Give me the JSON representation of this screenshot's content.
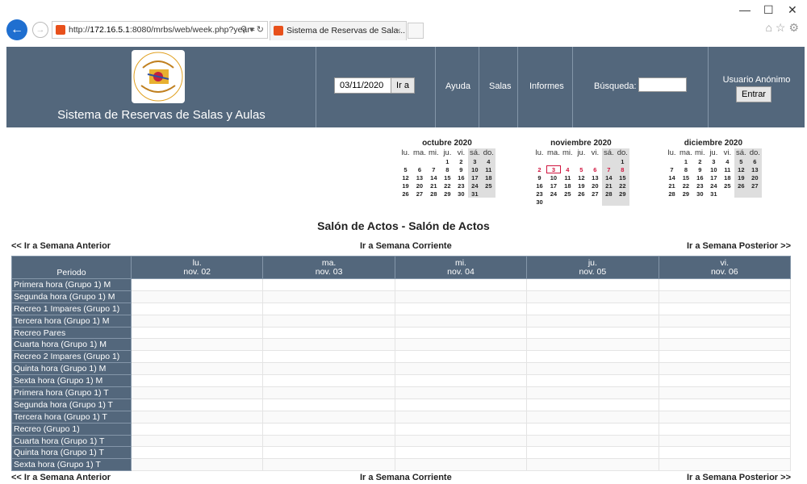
{
  "browser": {
    "url_prefix": "http://",
    "url_host": "172.16.5.1",
    "url_rest": ":8080/mrbs/web/week.php?year=",
    "tab_title": "Sistema de Reservas de Sala...",
    "tab_close": "×"
  },
  "header": {
    "site_title": "Sistema de Reservas de Salas y Aulas",
    "date_value": "03/11/2020",
    "go_button": "Ir a",
    "nav": {
      "help": "Ayuda",
      "rooms": "Salas",
      "reports": "Informes",
      "search_label": "Búsqueda:"
    },
    "user_label": "Usuario Anónimo",
    "login_button": "Entrar"
  },
  "weekday_short": [
    "lu.",
    "ma.",
    "mi.",
    "ju.",
    "vi.",
    "sá.",
    "do."
  ],
  "calendars": [
    {
      "title": "octubre 2020",
      "lead": 3,
      "days": 31
    },
    {
      "title": "noviembre 2020",
      "lead": 6,
      "days": 30,
      "highlight": [
        2,
        3,
        4,
        5,
        6,
        7,
        8
      ],
      "today": 3
    },
    {
      "title": "diciembre 2020",
      "lead": 1,
      "days": 31
    }
  ],
  "room_title": "Salón de Actos - Salón de Actos",
  "week_nav": {
    "prev": "<< Ir a Semana Anterior",
    "current": "Ir a Semana Corriente",
    "next": "Ir a Semana Posterior >>"
  },
  "grid": {
    "period_header": "Periodo",
    "days": [
      {
        "dow": "lu.",
        "date": "nov. 02"
      },
      {
        "dow": "ma.",
        "date": "nov. 03"
      },
      {
        "dow": "mi.",
        "date": "nov. 04"
      },
      {
        "dow": "ju.",
        "date": "nov. 05"
      },
      {
        "dow": "vi.",
        "date": "nov. 06"
      }
    ],
    "periods": [
      "Primera hora (Grupo 1) M",
      "Segunda hora (Grupo 1) M",
      "Recreo 1 Impares (Grupo 1)",
      "Tercera hora (Grupo 1) M",
      "Recreo Pares",
      "Cuarta hora (Grupo 1) M",
      "Recreo 2 Impares (Grupo 1)",
      "Quinta hora (Grupo 1) M",
      "Sexta hora (Grupo 1) M",
      "Primera hora (Grupo 1) T",
      "Segunda hora (Grupo 1) T",
      "Tercera hora (Grupo 1) T",
      "Recreo (Grupo 1)",
      "Cuarta hora (Grupo 1) T",
      "Quinta hora (Grupo 1) T",
      "Sexta hora (Grupo 1) T"
    ]
  },
  "colors": {
    "header_bg": "#53677c",
    "highlight_red": "#d0143e",
    "weekend_bg": "#dedede"
  }
}
